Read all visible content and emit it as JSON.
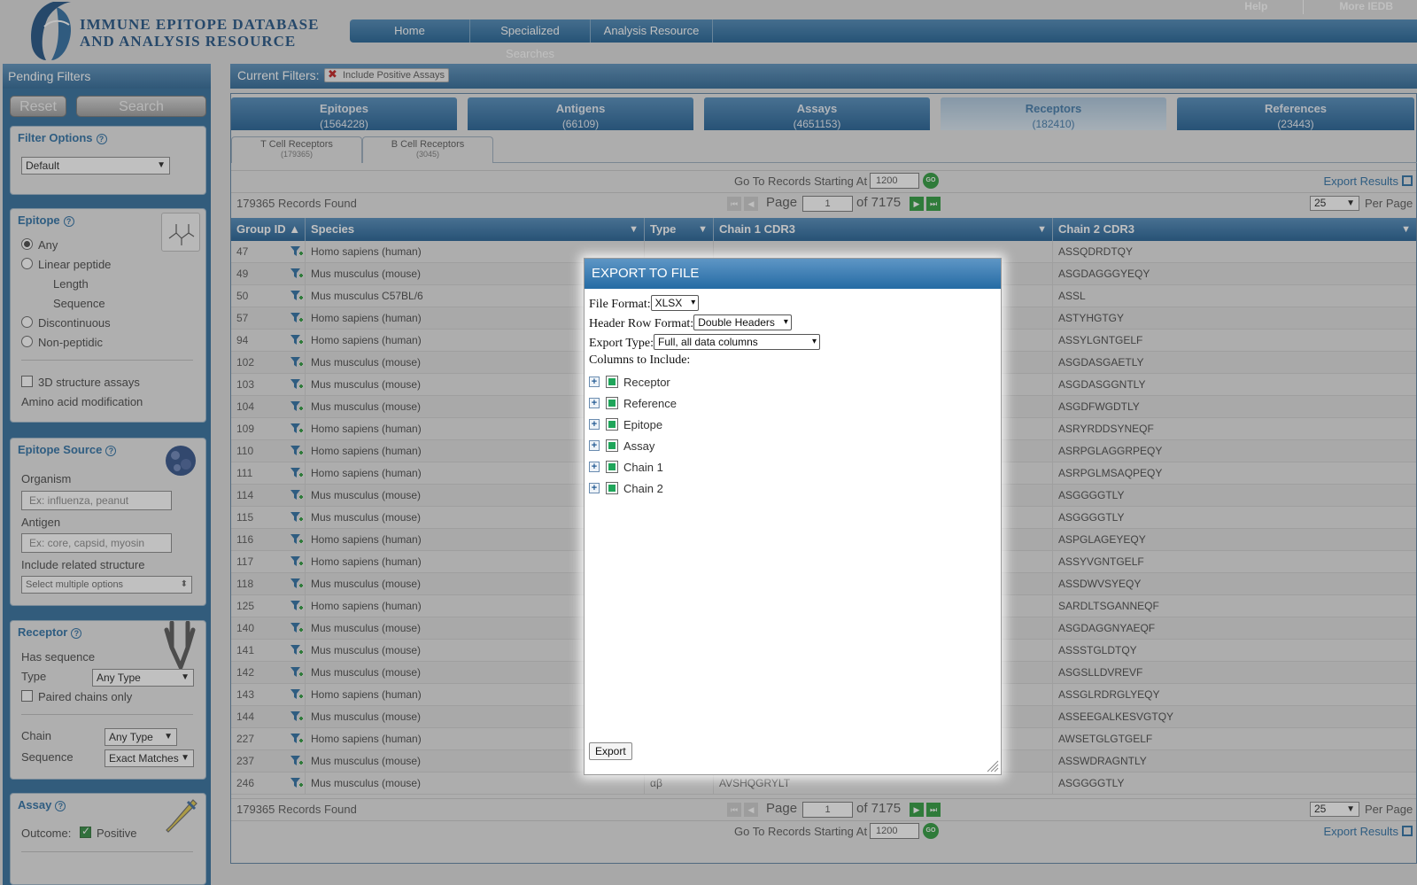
{
  "header": {
    "logo_line1": "IMMUNE EPITOPE DATABASE",
    "logo_line2": "AND ANALYSIS RESOURCE",
    "top_links": [
      "Help",
      "More IEDB"
    ],
    "nav": [
      "Home",
      "Specialized Searches",
      "Analysis Resource"
    ]
  },
  "sidebar": {
    "title": "Pending Filters",
    "reset_label": "Reset",
    "search_label": "Search",
    "filter_options": {
      "title": "Filter Options",
      "help": "?",
      "select": "Default"
    },
    "epitope": {
      "title": "Epitope",
      "help": "?",
      "any": "Any",
      "linear": "Linear peptide",
      "length": "Length",
      "sequence": "Sequence",
      "discontinuous": "Discontinuous",
      "non_peptidic": "Non-peptidic",
      "structure": "3D structure assays",
      "amino": "Amino acid modification"
    },
    "epitope_source": {
      "title": "Epitope Source",
      "help": "?",
      "organism": "Organism",
      "organism_placeholder": "Ex: influenza, peanut",
      "antigen": "Antigen",
      "antigen_placeholder": "Ex: core, capsid, myosin",
      "related": "Include related structure",
      "related_select": "Select multiple options"
    },
    "receptor": {
      "title": "Receptor",
      "help": "?",
      "has_sequence": "Has sequence",
      "type": "Type",
      "type_select": "Any Type",
      "paired": "Paired chains only",
      "chain": "Chain",
      "chain_select": "Any Type",
      "sequence": "Sequence",
      "sequence_select": "Exact Matches"
    },
    "assay": {
      "title": "Assay",
      "help": "?",
      "outcome": "Outcome:",
      "positive": "Positive"
    }
  },
  "filters": {
    "label": "Current Filters:",
    "chip": "Include Positive Assays"
  },
  "tabs": [
    {
      "name": "Epitopes",
      "count": "(1564228)"
    },
    {
      "name": "Antigens",
      "count": "(66109)"
    },
    {
      "name": "Assays",
      "count": "(4651153)"
    },
    {
      "name": "Receptors",
      "count": "(182410)"
    },
    {
      "name": "References",
      "count": "(23443)"
    }
  ],
  "subtabs": [
    {
      "name": "T Cell Receptors",
      "count": "(179365)"
    },
    {
      "name": "B Cell Receptors",
      "count": "(3045)"
    }
  ],
  "toolbar": {
    "goto_label": "Go To Records Starting At",
    "goto_value": "1200",
    "go": "GO",
    "export_results": "Export Results",
    "records_found": "179365 Records Found",
    "page_label": "Page",
    "page_value": "1",
    "of_pages": "of 7175",
    "per_page_value": "25",
    "per_page_label": "Per Page"
  },
  "table": {
    "columns": [
      "Group ID",
      "Species",
      "Type",
      "Chain 1 CDR3",
      "Chain 2 CDR3"
    ],
    "rows": [
      {
        "id": "47",
        "species": "Homo sapiens (human)",
        "type": "",
        "c1": "",
        "c2": "ASSQDRDTQY"
      },
      {
        "id": "49",
        "species": "Mus musculus (mouse)",
        "type": "",
        "c1": "",
        "c2": "ASGDAGGGYEQY"
      },
      {
        "id": "50",
        "species": "Mus musculus C57BL/6",
        "type": "",
        "c1": "",
        "c2": "ASSL"
      },
      {
        "id": "57",
        "species": "Homo sapiens (human)",
        "type": "",
        "c1": "",
        "c2": "ASTYHGTGY"
      },
      {
        "id": "94",
        "species": "Homo sapiens (human)",
        "type": "",
        "c1": "",
        "c2": "ASSYLGNTGELF"
      },
      {
        "id": "102",
        "species": "Mus musculus (mouse)",
        "type": "",
        "c1": "",
        "c2": "ASGDASGAETLY"
      },
      {
        "id": "103",
        "species": "Mus musculus (mouse)",
        "type": "",
        "c1": "",
        "c2": "ASGDASGGNTLY"
      },
      {
        "id": "104",
        "species": "Mus musculus (mouse)",
        "type": "",
        "c1": "",
        "c2": "ASGDFWGDTLY"
      },
      {
        "id": "109",
        "species": "Homo sapiens (human)",
        "type": "",
        "c1": "",
        "c2": "ASRYRDDSYNEQF"
      },
      {
        "id": "110",
        "species": "Homo sapiens (human)",
        "type": "",
        "c1": "",
        "c2": "ASRPGLAGGRPEQY"
      },
      {
        "id": "111",
        "species": "Homo sapiens (human)",
        "type": "",
        "c1": "",
        "c2": "ASRPGLMSAQPEQY"
      },
      {
        "id": "114",
        "species": "Mus musculus (mouse)",
        "type": "",
        "c1": "",
        "c2": "ASGGGGTLY"
      },
      {
        "id": "115",
        "species": "Mus musculus (mouse)",
        "type": "",
        "c1": "",
        "c2": "ASGGGGTLY"
      },
      {
        "id": "116",
        "species": "Homo sapiens (human)",
        "type": "",
        "c1": "",
        "c2": "ASPGLAGEYEQY"
      },
      {
        "id": "117",
        "species": "Homo sapiens (human)",
        "type": "",
        "c1": "",
        "c2": "ASSYVGNTGELF"
      },
      {
        "id": "118",
        "species": "Mus musculus (mouse)",
        "type": "",
        "c1": "",
        "c2": "ASSDWVSYEQY"
      },
      {
        "id": "125",
        "species": "Homo sapiens (human)",
        "type": "",
        "c1": "",
        "c2": "SARDLTSGANNEQF"
      },
      {
        "id": "140",
        "species": "Mus musculus (mouse)",
        "type": "",
        "c1": "",
        "c2": "ASGDAGGNYAEQF"
      },
      {
        "id": "141",
        "species": "Mus musculus (mouse)",
        "type": "",
        "c1": "",
        "c2": "ASSSTGLDTQY"
      },
      {
        "id": "142",
        "species": "Mus musculus (mouse)",
        "type": "",
        "c1": "",
        "c2": "ASGSLLDVREVF"
      },
      {
        "id": "143",
        "species": "Homo sapiens (human)",
        "type": "",
        "c1": "",
        "c2": "ASSGLRDRGLYEQY"
      },
      {
        "id": "144",
        "species": "Mus musculus (mouse)",
        "type": "",
        "c1": "",
        "c2": "ASSEEGALKESVGTQY"
      },
      {
        "id": "227",
        "species": "Homo sapiens (human)",
        "type": "",
        "c1": "",
        "c2": "AWSETGLGTGELF"
      },
      {
        "id": "237",
        "species": "Mus musculus (mouse)",
        "type": "",
        "c1": "",
        "c2": "ASSWDRAGNTLY"
      },
      {
        "id": "246",
        "species": "Mus musculus (mouse)",
        "type": "αβ",
        "c1": "AVSHQGRYLT",
        "c2": "ASGGGGTLY"
      }
    ]
  },
  "modal": {
    "title": "EXPORT TO FILE",
    "file_format_label": "File Format:",
    "file_format_value": "XLSX",
    "header_row_label": "Header Row Format:",
    "header_row_value": "Double Headers",
    "export_type_label": "Export Type:",
    "export_type_value": "Full, all data columns",
    "columns_label": "Columns to Include:",
    "columns": [
      "Receptor",
      "Reference",
      "Epitope",
      "Assay",
      "Chain 1",
      "Chain 2"
    ],
    "export_button": "Export"
  }
}
